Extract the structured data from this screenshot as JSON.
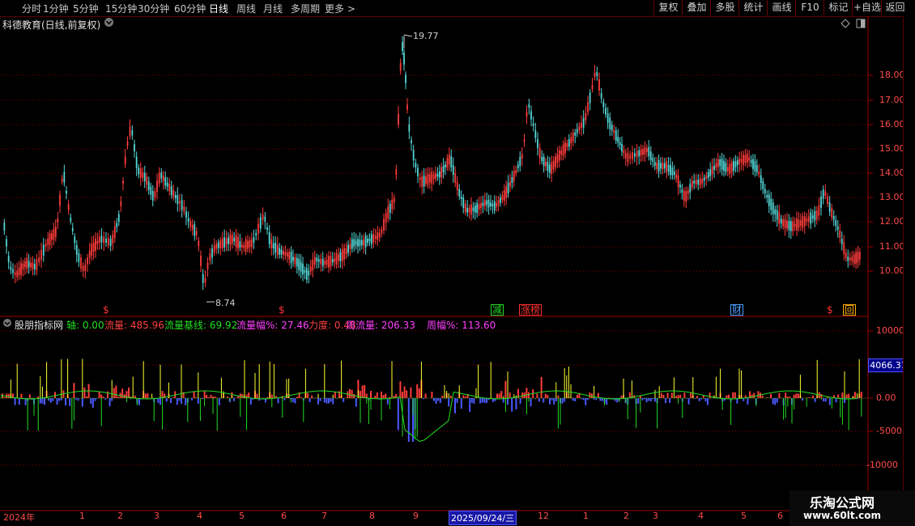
{
  "periods": [
    "分时",
    "1分钟",
    "5分钟",
    "15分钟",
    "30分钟",
    "60分钟",
    "日线",
    "周线",
    "月线",
    "多周期",
    "更多 >"
  ],
  "active_period": "日线",
  "toolbar": [
    "复权",
    "叠加",
    "多股",
    "统计",
    "画线",
    "F10",
    "标记",
    "+自选",
    "返回"
  ],
  "chart_title": "科德教育(日线,前复权)",
  "price_axis": [
    "18.00",
    "17.00",
    "16.00",
    "15.00",
    "14.00",
    "13.00",
    "12.00",
    "11.00",
    "10.00"
  ],
  "high_label": "19.77",
  "low_label": "8.74",
  "markers": [
    {
      "text": "$",
      "color": "#ff3030"
    },
    {
      "text": "$",
      "color": "#ff3030"
    },
    {
      "text": "减",
      "color": "#22dd22"
    },
    {
      "text": "涨榜",
      "color": "#ff3030"
    },
    {
      "text": "财",
      "color": "#4aa0ff"
    },
    {
      "text": "$",
      "color": "#ff3030"
    },
    {
      "text": "回",
      "color": "#ffaa00"
    }
  ],
  "indicator": {
    "name": "股朋指标网",
    "items": [
      {
        "label": "轴: 0.00",
        "color": "#22dd22"
      },
      {
        "label": "流量: 485.96",
        "color": "#ff4040"
      },
      {
        "label": "流量基线: 69.92",
        "color": "#22dd22"
      },
      {
        "label": "流量幅%: 27.46",
        "color": "#ff40ff"
      },
      {
        "label": "力度: 0.48",
        "color": "#ff4040"
      },
      {
        "label": "周流量: 206.33",
        "color": "#ff40ff"
      },
      {
        "label": "周幅%: 113.60",
        "color": "#ff40ff"
      }
    ],
    "axis": [
      "10000",
      "5000",
      "0.00",
      "-5000",
      "-10000"
    ],
    "current_value": "4066.31"
  },
  "x_labels": [
    "2024年",
    "1",
    "2",
    "3",
    "4",
    "5",
    "6",
    "7",
    "8",
    "9",
    "2025/09/24/三",
    "12",
    "1",
    "2",
    "3",
    "4",
    "5",
    "6"
  ],
  "watermark": {
    "title": "乐淘公式网",
    "url": "www.60lt.com"
  },
  "colors": {
    "up": "#ff3c3c",
    "down": "#54d8d8",
    "blue_bar": "#4a58ff",
    "grid": "#8b0000",
    "volume_line": "#ffff30"
  }
}
